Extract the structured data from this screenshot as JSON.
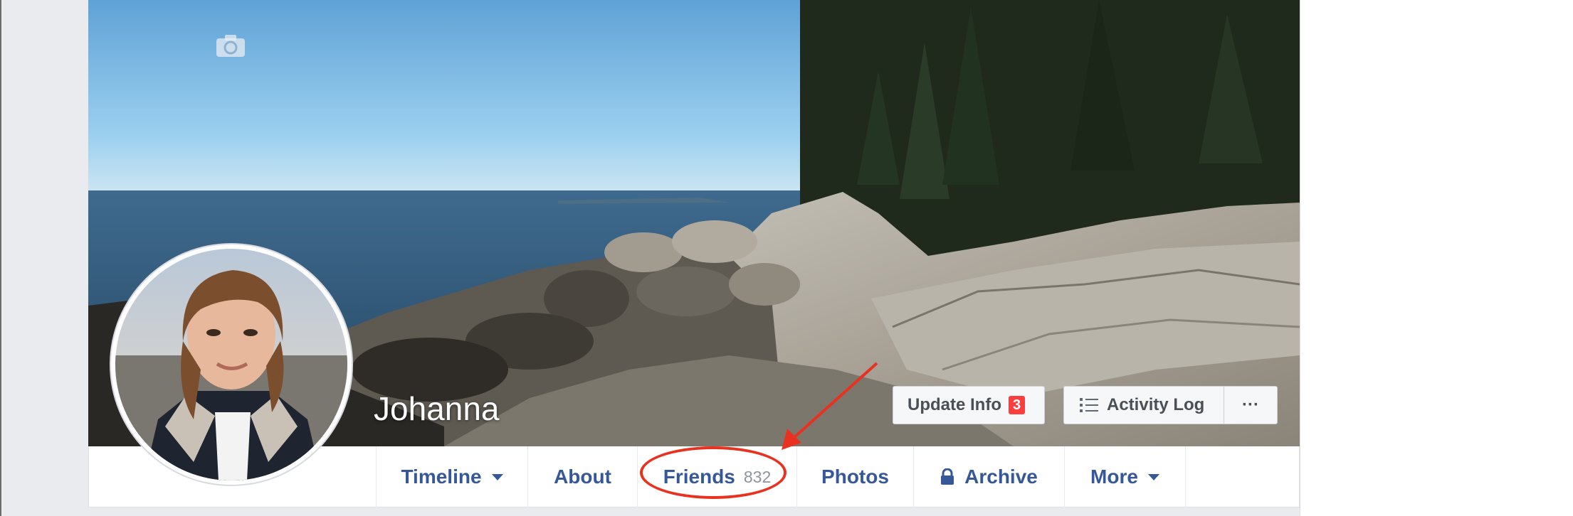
{
  "profile": {
    "name": "Johanna"
  },
  "cover": {
    "camera_icon": "camera-icon"
  },
  "actions": {
    "update_info_label": "Update Info",
    "update_info_badge": "3",
    "activity_log_label": "Activity Log",
    "more_options_label": "···"
  },
  "tabs": [
    {
      "label": "Timeline",
      "has_caret": true
    },
    {
      "label": "About"
    },
    {
      "label": "Friends",
      "count": "832"
    },
    {
      "label": "Photos"
    },
    {
      "label": "Archive",
      "icon": "lock-icon"
    },
    {
      "label": "More",
      "has_caret": true
    }
  ],
  "colors": {
    "link_blue": "#365899",
    "badge_red": "#fa3e3e",
    "annotation_red": "#e8321f"
  }
}
